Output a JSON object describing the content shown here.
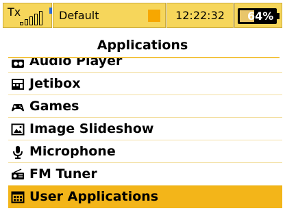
{
  "status_bar": {
    "tx_label": "Tx",
    "tx_signal_icon": "signal-bars-icon",
    "model_name": "Default",
    "time": "12:22:32",
    "battery_percent_text": "64%",
    "battery_level": 0.64,
    "colors": {
      "segment_bg": "#f6d65b",
      "accent": "#f7a700",
      "tx_dot": "#2c6bd6"
    }
  },
  "page": {
    "title": "Applications"
  },
  "menu": {
    "items": [
      {
        "label": "Audio Player",
        "icon": "audio-player-icon",
        "partial": true
      },
      {
        "label": "Jetibox",
        "icon": "jetibox-icon"
      },
      {
        "label": "Games",
        "icon": "gamepad-icon"
      },
      {
        "label": "Image Slideshow",
        "icon": "image-icon"
      },
      {
        "label": "Microphone",
        "icon": "microphone-icon"
      },
      {
        "label": "FM Tuner",
        "icon": "radio-icon"
      },
      {
        "label": "User Applications",
        "icon": "apps-icon",
        "selected": true
      }
    ],
    "colors": {
      "selected_bg": "#f3b519",
      "separator": "#f3dfa1"
    }
  }
}
